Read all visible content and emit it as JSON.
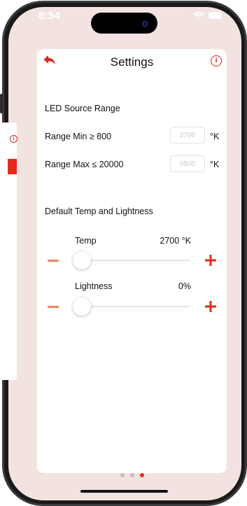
{
  "status_bar": {
    "time": "8:54"
  },
  "header": {
    "title": "Settings"
  },
  "led_range": {
    "section_title": "LED Source Range",
    "min_label": "Range Min ≥ 800",
    "min_placeholder": "2700",
    "max_label": "Range Max ≤ 20000",
    "max_placeholder": "6500",
    "unit": "°K"
  },
  "defaults": {
    "section_title": "Default Temp and Lightness",
    "temp": {
      "label": "Temp",
      "value": "2700 °K",
      "slider_fraction": 0
    },
    "lightness": {
      "label": "Lightness",
      "value": "0%",
      "slider_fraction": 0
    }
  },
  "page_indicator": {
    "count": 3,
    "active_index": 2
  },
  "colors": {
    "accent": "#d62b1f",
    "minus": "#f08160",
    "background": "#f2e3e1"
  }
}
